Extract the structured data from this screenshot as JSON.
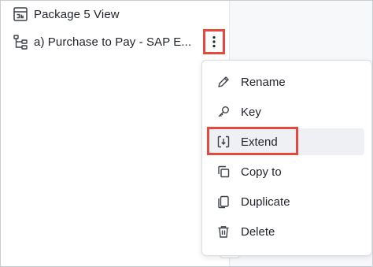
{
  "tree": {
    "items": [
      {
        "label": "Package 5 View",
        "icon": "package-view-icon"
      },
      {
        "label": "a) Purchase to Pay - SAP E...",
        "icon": "hierarchy-icon"
      }
    ],
    "more_icon": "vertical-ellipsis-icon"
  },
  "context_menu": {
    "items": [
      {
        "label": "Rename",
        "icon": "pencil-icon"
      },
      {
        "label": "Key",
        "icon": "key-icon"
      },
      {
        "label": "Extend",
        "icon": "extend-icon"
      },
      {
        "label": "Copy to",
        "icon": "copy-icon"
      },
      {
        "label": "Duplicate",
        "icon": "duplicate-icon"
      },
      {
        "label": "Delete",
        "icon": "trash-icon"
      }
    ],
    "highlighted_item": "Extend"
  },
  "colors": {
    "callout": "#e5483d",
    "hover": "#eef0f3",
    "text": "#1f2329",
    "icon": "#3c4149"
  }
}
